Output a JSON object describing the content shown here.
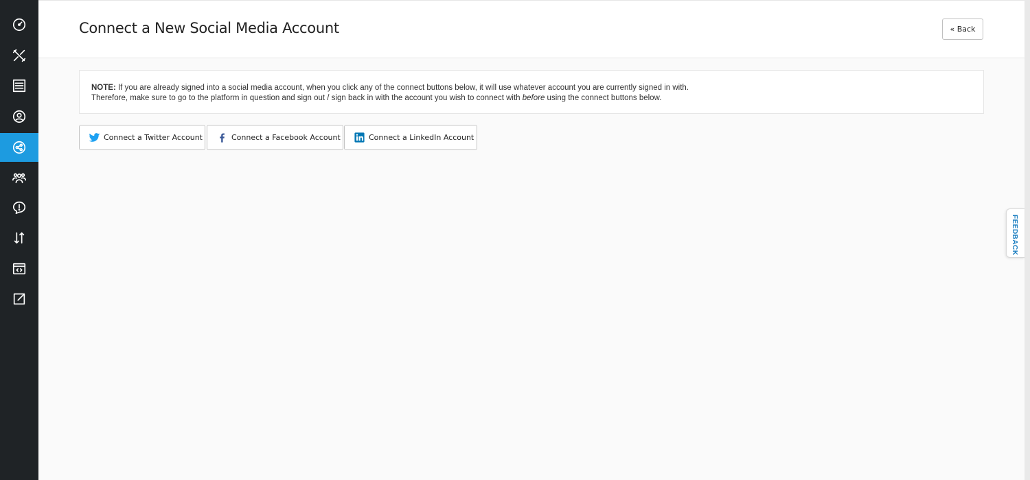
{
  "sidebar": {
    "items": [
      {
        "icon": "dashboard-icon",
        "active": false
      },
      {
        "icon": "tools-icon",
        "active": false
      },
      {
        "icon": "newspaper-icon",
        "active": false
      },
      {
        "icon": "user-circle-icon",
        "active": false
      },
      {
        "icon": "share-icon",
        "active": true
      },
      {
        "icon": "users-group-icon",
        "active": false
      },
      {
        "icon": "alert-bubble-icon",
        "active": false
      },
      {
        "icon": "sort-arrows-icon",
        "active": false
      },
      {
        "icon": "code-window-icon",
        "active": false
      },
      {
        "icon": "external-link-icon",
        "active": false
      }
    ],
    "active_color": "#1d9be0",
    "background": "#1f2326"
  },
  "header": {
    "title": "Connect a New Social Media Account",
    "back_label": "« Back"
  },
  "note": {
    "prefix": "NOTE:",
    "line1": " If you are already signed into a social media account, when you click any of the connect buttons below, it will use whatever account you are currently signed in with.",
    "line2_start": "Therefore, make sure to go to the platform in question and sign out / sign back in with the account you wish to connect with ",
    "line2_emphasis": "before",
    "line2_end": " using the connect buttons below."
  },
  "connect_buttons": [
    {
      "label": "Connect a Twitter Account",
      "icon": "twitter-icon",
      "color": "#1da1f2"
    },
    {
      "label": "Connect a Facebook Account",
      "icon": "facebook-icon",
      "color": "#3b5998"
    },
    {
      "label": "Connect a LinkedIn Account",
      "icon": "linkedin-icon",
      "color": "#0077b5"
    }
  ],
  "feedback": {
    "label": "FEEDBACK"
  }
}
